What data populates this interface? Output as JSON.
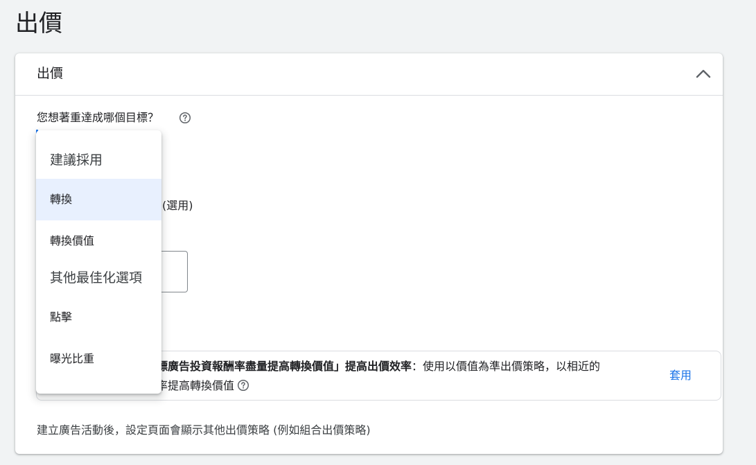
{
  "page": {
    "title": "出價"
  },
  "card": {
    "title": "出價",
    "question": "您想著重達成哪個目標？",
    "optional_label": "(選用)",
    "recommendation": {
      "line1_bold": "標廣告投資報酬率盡量提高轉換價值」提高出價效率",
      "line1_rest": "：使用以價值為準出價策略，以相近的",
      "line2": "率提高轉換價值",
      "apply_label": "套用"
    },
    "footer_note": "建立廣告活動後，設定頁面會顯示其他出價策略 (例如組合出價策略)"
  },
  "dropdown": {
    "group1": "建議採用",
    "items1": [
      "轉換",
      "轉換價值"
    ],
    "group2": "其他最佳化選項",
    "items2": [
      "點擊",
      "曝光比重"
    ],
    "selected": "轉換"
  },
  "icons": {
    "collapse": "chevron-up-icon",
    "help": "help-circle-icon"
  },
  "colors": {
    "accent": "#1a73e8",
    "selected_bg": "#e8f0fe"
  }
}
